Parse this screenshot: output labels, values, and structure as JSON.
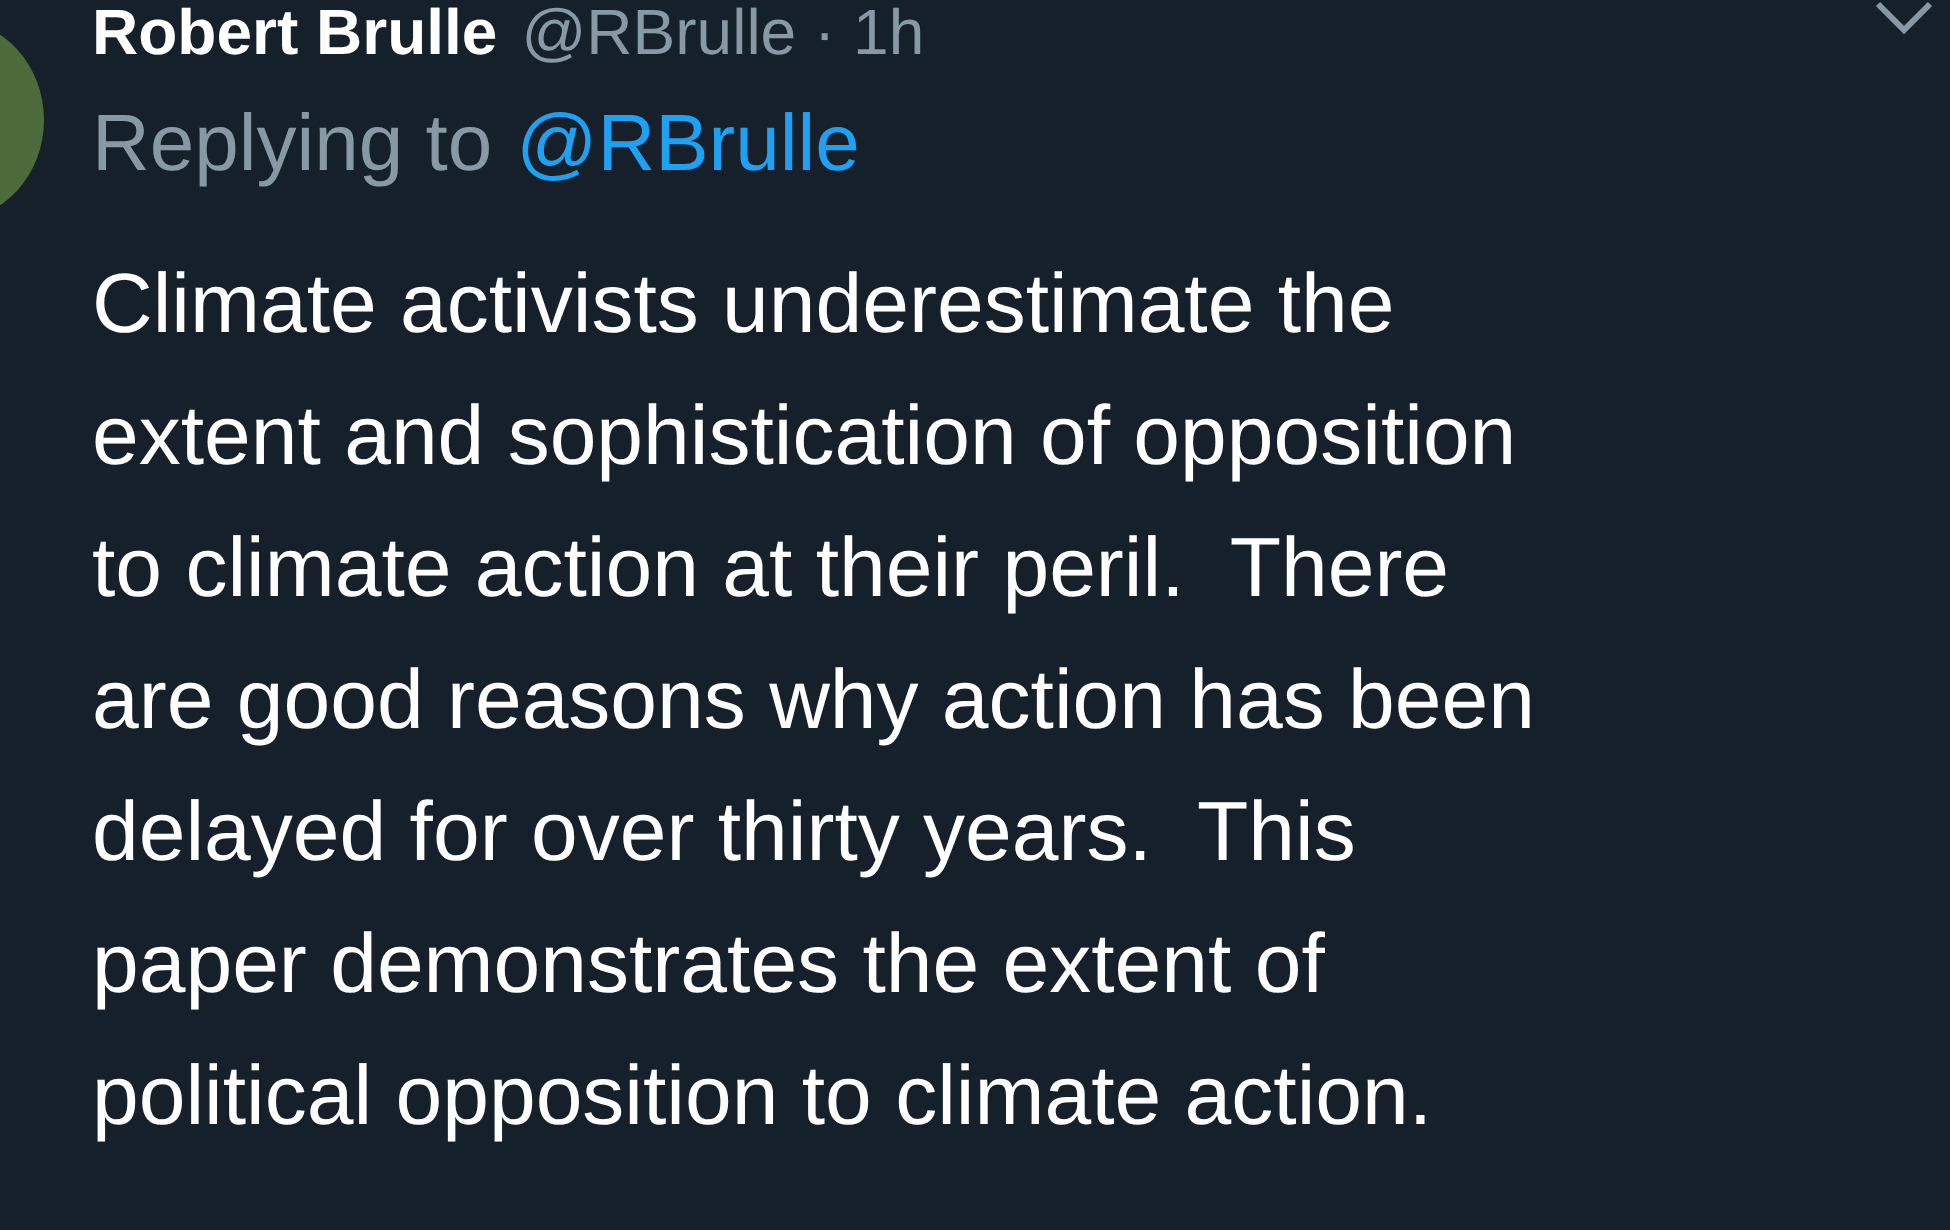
{
  "tweet": {
    "author_name": "Robert Brulle",
    "handle_time": "@RBrulle · 1h",
    "replying_label": "Replying to",
    "replying_handle": "@RBrulle",
    "text": "Climate activists underestimate the\nextent and sophistication of opposition\nto climate action at their peril.  There\nare good reasons why action has been\ndelayed for over thirty years.  This\npaper demonstrates the extent of\npolitical opposition to climate action."
  }
}
